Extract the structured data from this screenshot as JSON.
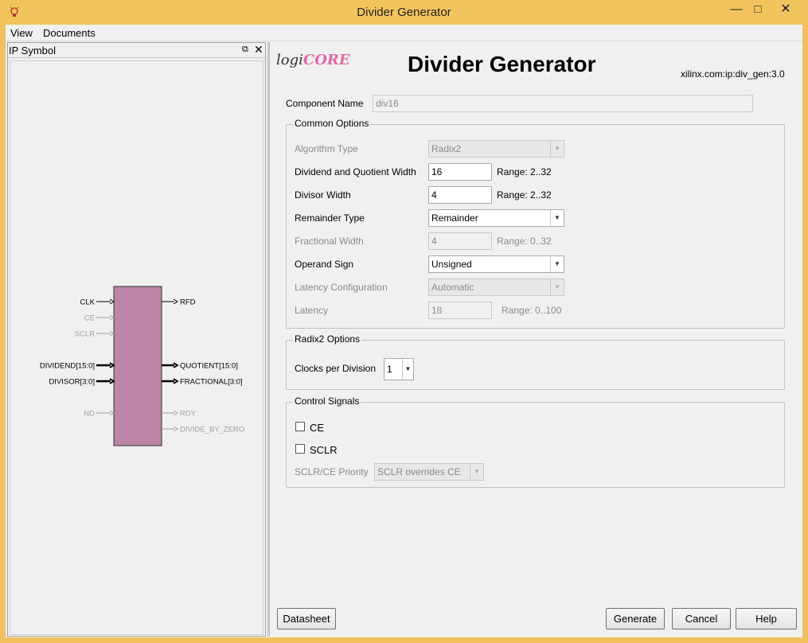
{
  "window": {
    "title": "Divider Generator",
    "controls": {
      "minimize": "—",
      "maximize": "□",
      "close": "✕"
    }
  },
  "menu": {
    "view": "View",
    "documents": "Documents"
  },
  "left_panel": {
    "title": "IP Symbol",
    "symbol": {
      "block_color": "#bd85a6",
      "inputs": [
        {
          "name": "CLK",
          "active": true,
          "bus": false
        },
        {
          "name": "CE",
          "active": false,
          "bus": false
        },
        {
          "name": "SCLR",
          "active": false,
          "bus": false
        },
        {
          "name": "DIVIDEND[15:0]",
          "active": true,
          "bus": true
        },
        {
          "name": "DIVISOR[3:0]",
          "active": true,
          "bus": true
        },
        {
          "name": "ND",
          "active": false,
          "bus": false
        }
      ],
      "outputs": [
        {
          "name": "RFD",
          "active": true,
          "bus": false
        },
        {
          "name": "QUOTIENT[15:0]",
          "active": true,
          "bus": true
        },
        {
          "name": "FRACTIONAL[3:0]",
          "active": true,
          "bus": true
        },
        {
          "name": "RDY",
          "active": false,
          "bus": false
        },
        {
          "name": "DIVIDE_BY_ZERO",
          "active": false,
          "bus": false
        }
      ]
    }
  },
  "header": {
    "logo_logi": "logi",
    "logo_core": "CORE",
    "title": "Divider Generator",
    "vlnv": "xilinx.com:ip:div_gen:3.0"
  },
  "component_name": {
    "label": "Component Name",
    "value": "div16"
  },
  "common_options": {
    "title": "Common Options",
    "algorithm_type": {
      "label": "Algorithm Type",
      "value": "Radix2"
    },
    "dividend_width": {
      "label": "Dividend and Quotient Width",
      "value": "16",
      "range": "Range: 2..32"
    },
    "divisor_width": {
      "label": "Divisor Width",
      "value": "4",
      "range": "Range: 2..32"
    },
    "remainder_type": {
      "label": "Remainder Type",
      "value": "Remainder"
    },
    "fractional_width": {
      "label": "Fractional Width",
      "value": "4",
      "range": "Range: 0..32"
    },
    "operand_sign": {
      "label": "Operand Sign",
      "value": "Unsigned"
    },
    "latency_config": {
      "label": "Latency Configuration",
      "value": "Automatic"
    },
    "latency": {
      "label": "Latency",
      "value": "18",
      "range": "Range: 0..100"
    }
  },
  "radix2_options": {
    "title": "Radix2 Options",
    "clocks_per_division": {
      "label": "Clocks per Division",
      "value": "1"
    }
  },
  "control_signals": {
    "title": "Control Signals",
    "ce": {
      "label": "CE",
      "checked": false
    },
    "sclr": {
      "label": "SCLR",
      "checked": false
    },
    "priority": {
      "label": "SCLR/CE Priority",
      "value": "SCLR overrides CE"
    }
  },
  "buttons": {
    "datasheet": "Datasheet",
    "generate": "Generate",
    "cancel": "Cancel",
    "help": "Help"
  }
}
